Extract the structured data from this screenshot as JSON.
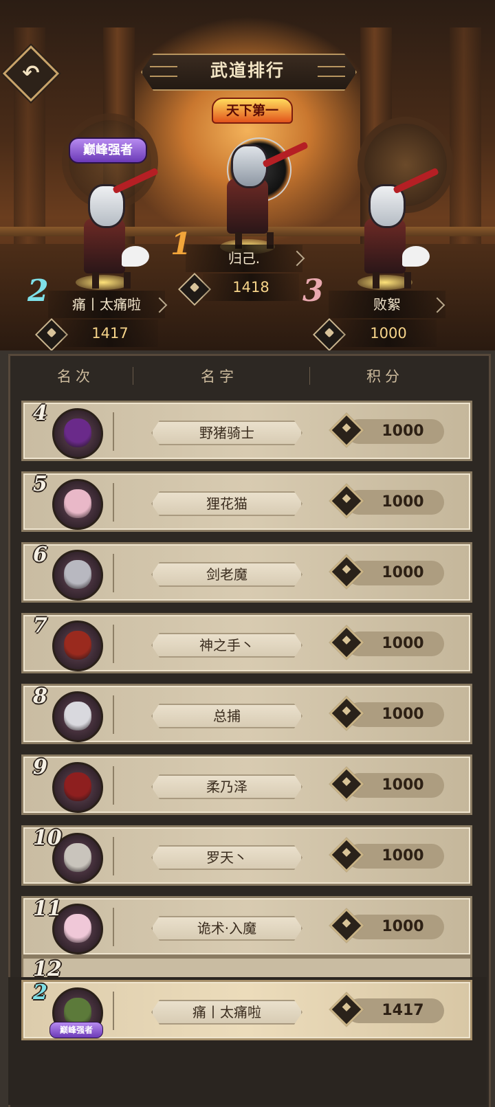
{
  "header": {
    "title": "武道排行",
    "champion_badge": "天下第一",
    "peak_badge": "巅峰强者"
  },
  "podium": [
    {
      "rank": "1",
      "name": "归己.",
      "score": "1418",
      "color": "#f2a53a"
    },
    {
      "rank": "2",
      "name": "痛丨太痛啦",
      "score": "1417",
      "color": "#7fe0e8"
    },
    {
      "rank": "3",
      "name": "败絮",
      "score": "1000",
      "color": "#e9a9b0"
    }
  ],
  "table": {
    "col_rank": "名次",
    "col_name": "名字",
    "col_score": "积分"
  },
  "rows": [
    {
      "rank": "4",
      "name": "野猪骑士",
      "score": "1000",
      "avatar_color": "#6a2a8a"
    },
    {
      "rank": "5",
      "name": "狸花猫",
      "score": "1000",
      "avatar_color": "#e9b8c8"
    },
    {
      "rank": "6",
      "name": "剑老魔",
      "score": "1000",
      "avatar_color": "#b8b8c0"
    },
    {
      "rank": "7",
      "name": "神之手丶",
      "score": "1000",
      "avatar_color": "#9a2a1e"
    },
    {
      "rank": "8",
      "name": "总捕",
      "score": "1000",
      "avatar_color": "#d9d9de"
    },
    {
      "rank": "9",
      "name": "柔乃泽",
      "score": "1000",
      "avatar_color": "#8e1f1f"
    },
    {
      "rank": "10",
      "name": "罗天丶",
      "score": "1000",
      "avatar_color": "#c9c4bc"
    },
    {
      "rank": "11",
      "name": "诡术·入魔",
      "score": "1000",
      "avatar_color": "#f0c8d8"
    },
    {
      "rank": "12"
    }
  ],
  "my_entry": {
    "rank": "2",
    "name": "痛丨太痛啦",
    "score": "1417",
    "badge": "巅峰强者",
    "avatar_color": "#5c7a3a"
  }
}
